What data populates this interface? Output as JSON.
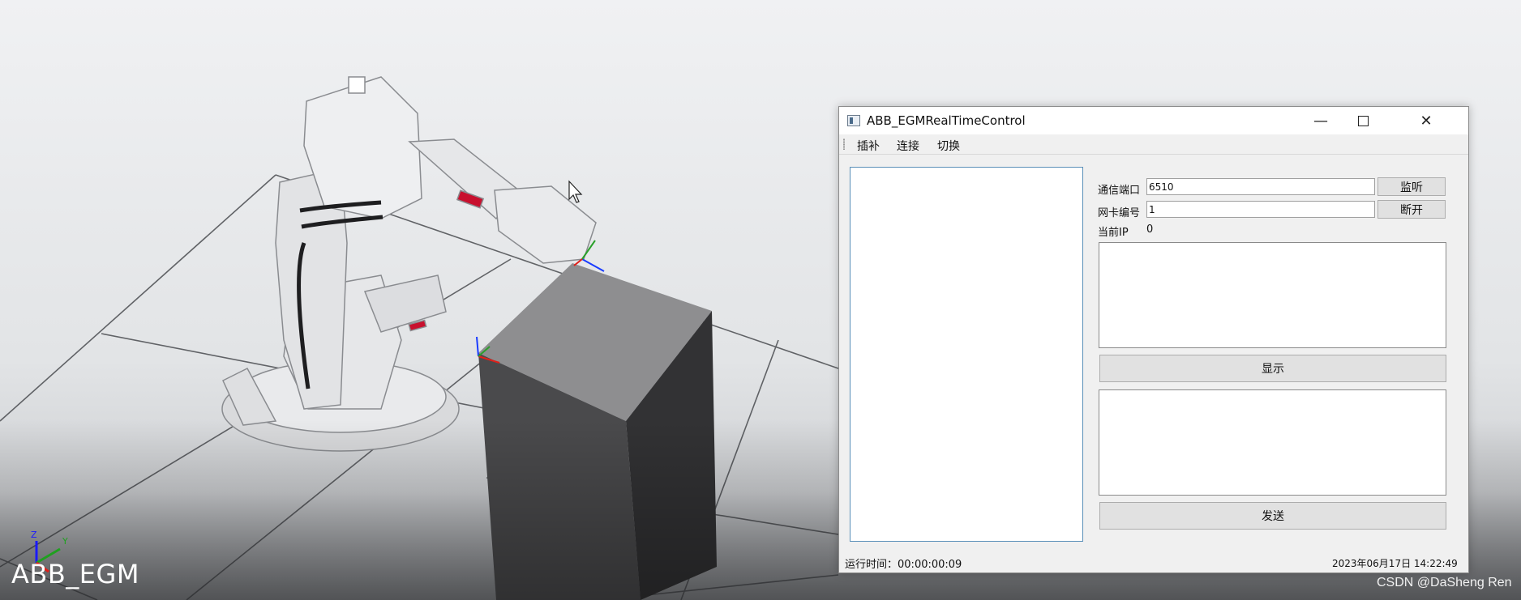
{
  "viewport": {
    "title": "ABB_EGM",
    "axis_labels": {
      "z": "Z",
      "y": "Y"
    },
    "watermark": "CSDN @DaSheng Ren"
  },
  "window": {
    "title": "ABB_EGMRealTimeControl",
    "minimize_symbol": "—",
    "close_symbol": "✕"
  },
  "menu": {
    "items": [
      {
        "label": "插补"
      },
      {
        "label": "连接"
      },
      {
        "label": "切换"
      }
    ]
  },
  "form": {
    "port_label": "通信端口",
    "port_value": "6510",
    "listen_button": "监听",
    "nic_label": "网卡编号",
    "nic_value": "1",
    "disconnect_button": "断开",
    "current_ip_label": "当前IP",
    "current_ip_value": "0",
    "show_button": "显示",
    "send_button": "发送"
  },
  "status": {
    "runtime_label": "运行时间：",
    "runtime_value": "00:00:00:09",
    "datetime": "2023年06月17日  14:22:49"
  },
  "colors": {
    "robot_body": "#e6e7e9",
    "box_top": "#8e8e90",
    "box_front": "#4a4a4c",
    "box_side": "#323234",
    "accent_blue": "#5a8fb8"
  }
}
